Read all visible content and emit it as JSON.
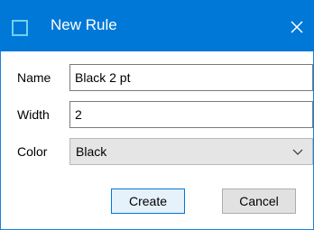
{
  "window": {
    "title": "New Rule",
    "icons": {
      "app": "app-window-icon",
      "close": "close-icon"
    }
  },
  "form": {
    "name": {
      "label": "Name",
      "value": "Black 2 pt"
    },
    "width": {
      "label": "Width",
      "value": "2"
    },
    "color": {
      "label": "Color",
      "selected": "Black"
    }
  },
  "buttons": {
    "create": "Create",
    "cancel": "Cancel"
  },
  "colors": {
    "titlebar": "#0078d7",
    "accent_border": "#0078d7"
  }
}
